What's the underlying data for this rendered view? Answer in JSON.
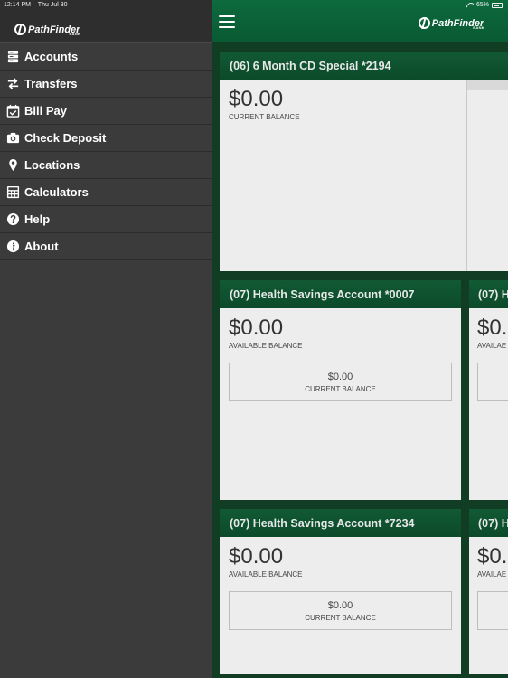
{
  "status_bar": {
    "time": "12:14 PM",
    "date": "Thu Jul 30",
    "battery": "65%"
  },
  "brand": {
    "name": "PathFinder",
    "sub": "BANK"
  },
  "sidebar": {
    "items": [
      {
        "label": "Accounts",
        "icon": "accounts-icon"
      },
      {
        "label": "Transfers",
        "icon": "transfer-arrows-icon"
      },
      {
        "label": "Bill Pay",
        "icon": "calendar-check-icon"
      },
      {
        "label": "Check Deposit",
        "icon": "camera-icon"
      },
      {
        "label": "Locations",
        "icon": "map-pin-icon"
      },
      {
        "label": "Calculators",
        "icon": "calculator-icon"
      },
      {
        "label": "Help",
        "icon": "help-icon"
      },
      {
        "label": "About",
        "icon": "info-icon"
      }
    ]
  },
  "accounts": [
    {
      "title": "(06) 6 Month CD Special *2194",
      "amount": "$0.00",
      "label": "CURRENT BALANCE"
    },
    {
      "title": "(07) Health Savings Account *0007",
      "amount": "$0.00",
      "label": "AVAILABLE BALANCE",
      "sub_amount": "$0.00",
      "sub_label": "CURRENT BALANCE"
    },
    {
      "title": "(07) Health Savings Account *7234",
      "amount": "$0.00",
      "label": "AVAILABLE BALANCE",
      "sub_amount": "$0.00",
      "sub_label": "CURRENT BALANCE"
    }
  ],
  "peek_cards": [
    {
      "title": "(07) H",
      "amount": "$0.",
      "label": "AVAILAE"
    },
    {
      "title": "(07) H",
      "amount": "$0.",
      "label": "AVAILAE"
    }
  ],
  "colors": {
    "accent": "#0c6a3d",
    "sidebar": "#3b3b3b",
    "card": "#ededed"
  }
}
